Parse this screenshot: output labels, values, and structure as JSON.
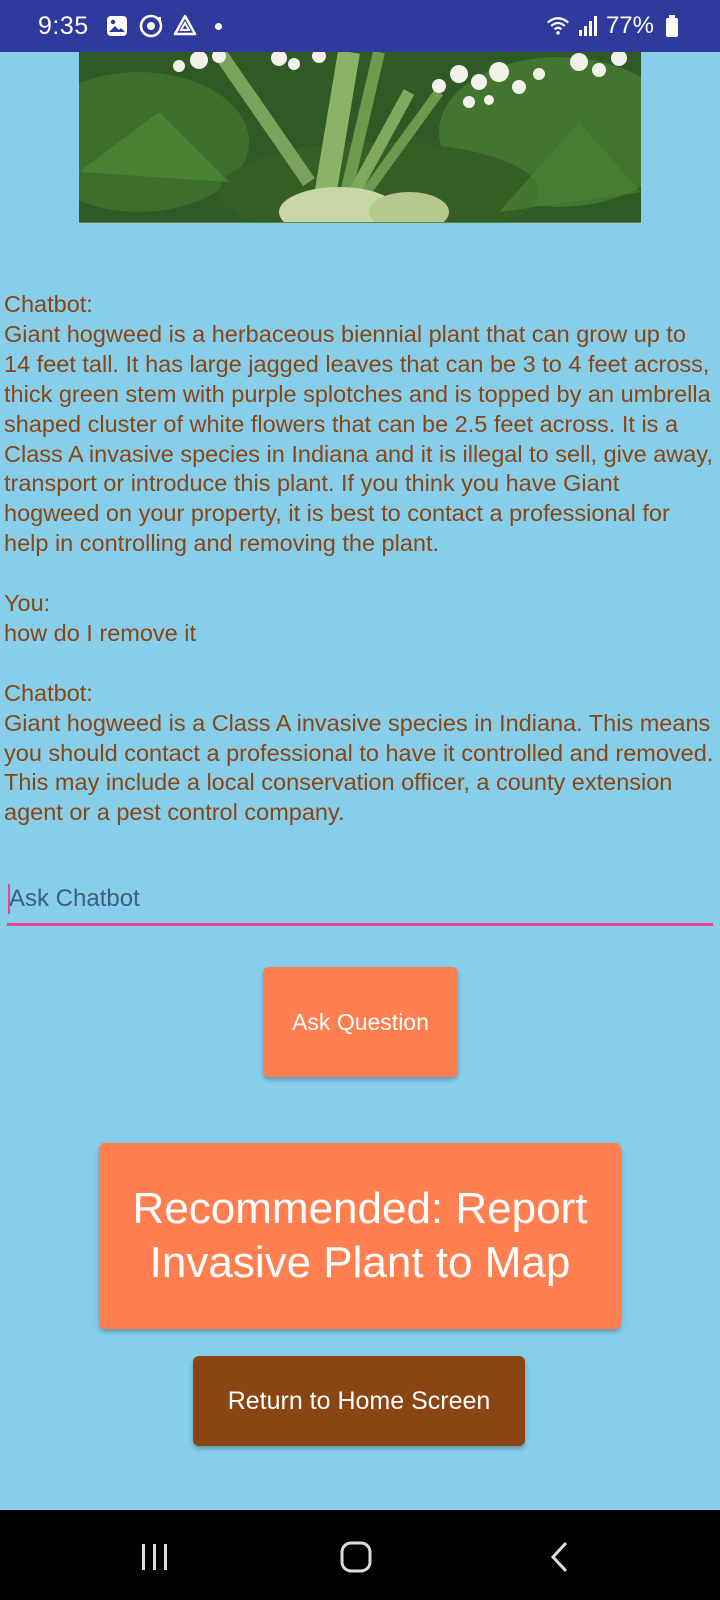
{
  "status_bar": {
    "time": "9:35",
    "battery": "77%"
  },
  "icons": {
    "status": [
      "gallery-icon",
      "sync-icon",
      "drive-icon",
      "notification-dot-icon",
      "wifi-icon",
      "signal-icon",
      "battery-icon"
    ],
    "nav": [
      "recent-apps-icon",
      "home-icon",
      "back-icon"
    ]
  },
  "chat": {
    "messages": [
      {
        "speaker": "Chatbot:",
        "text": "Giant hogweed is a herbaceous biennial plant that can grow up to 14 feet tall. It has large jagged leaves that can be 3 to 4 feet across, thick green stem with purple splotches and is topped by an umbrella shaped cluster of white flowers that can be 2.5 feet across. It is a Class A invasive species in Indiana and it is illegal to sell, give away, transport or introduce this plant. If you think you have Giant hogweed on your property, it is best to contact a professional for help in controlling and removing the plant."
      },
      {
        "speaker": "You:",
        "text": "how do I remove it"
      },
      {
        "speaker": "Chatbot:",
        "text": "Giant hogweed is a Class A invasive species in Indiana. This means you should contact a professional to have it controlled and removed. This may include a local conservation officer, a county extension agent or a pest control company."
      }
    ]
  },
  "input": {
    "placeholder": "Ask Chatbot",
    "value": ""
  },
  "buttons": {
    "ask": "Ask Question",
    "report": "Recommended: Report Invasive Plant to Map",
    "home": "Return to Home Screen"
  },
  "colors": {
    "background": "#87CEEB",
    "status_bar": "#2E3B9C",
    "chat_text": "#8B4513",
    "accent_button": "#FF7F50",
    "home_button": "#8B4513",
    "input_underline": "#E8478C"
  }
}
